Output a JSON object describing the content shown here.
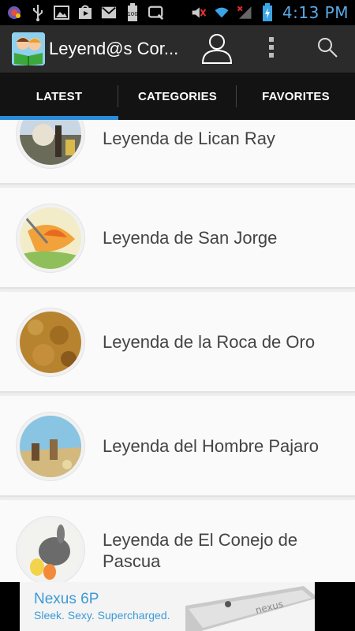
{
  "status_bar": {
    "time": "4:13 PM",
    "battery_label": "100",
    "icons": [
      "notification-icon",
      "usb-icon",
      "gallery-icon",
      "play-store-icon",
      "gmail-icon",
      "battery-widget-icon",
      "speech-bubble-icon",
      "muted-volume-icon",
      "wifi-icon",
      "signal-icon",
      "battery-charging-icon"
    ]
  },
  "app_bar": {
    "title": "Leyend@s Cor...",
    "icons": [
      "app-logo",
      "profile-icon",
      "overflow-menu-icon",
      "search-icon"
    ]
  },
  "tabs": [
    {
      "label": "LATEST",
      "active": true
    },
    {
      "label": "CATEGORIES",
      "active": false
    },
    {
      "label": "FAVORITES",
      "active": false
    }
  ],
  "legends": [
    {
      "title": "Leyenda de Lican Ray"
    },
    {
      "title": "Leyenda de San Jorge"
    },
    {
      "title": "Leyenda de la Roca de Oro"
    },
    {
      "title": "Leyenda del Hombre Pajaro"
    },
    {
      "title": "Leyenda de El Conejo de Pascua"
    }
  ],
  "ad": {
    "brand": "Nexus 6P",
    "tagline": "Sleek. Sexy. Supercharged.",
    "product_text": "nexus"
  },
  "colors": {
    "accent": "#2a8bd8",
    "time": "#5aa9e6",
    "tab_bar": "#131313",
    "app_bar": "#2b2b2b"
  }
}
